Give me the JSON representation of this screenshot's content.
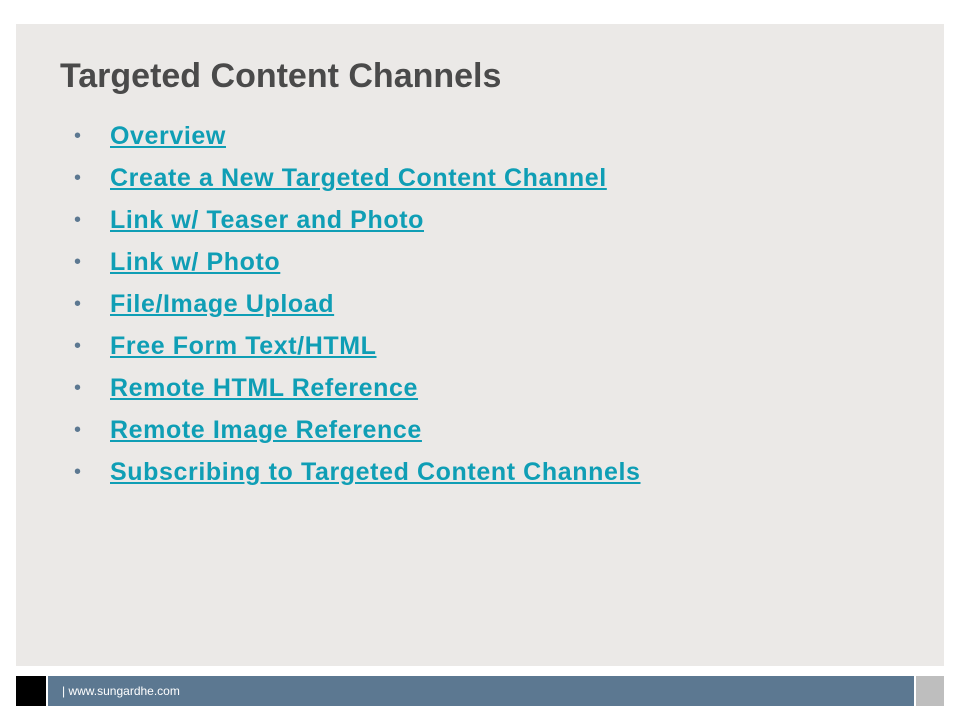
{
  "slide": {
    "title": "Targeted Content Channels",
    "bullet_glyph": "•",
    "links": [
      "Overview",
      "Create a New Targeted Content Channel",
      "Link w/ Teaser and Photo",
      "Link w/ Photo",
      "File/Image Upload",
      "Free Form Text/HTML",
      "Remote HTML Reference",
      "Remote Image Reference",
      "Subscribing to Targeted Content Channels"
    ]
  },
  "footer": {
    "text": "| www.sungardhe.com"
  },
  "colors": {
    "panel_background": "#ebe9e7",
    "title_text": "#4a4a4a",
    "link": "#0f9eb5",
    "footer_bar": "#5c7891",
    "footer_left_block": "#000000",
    "footer_right_block": "#bebebe"
  }
}
